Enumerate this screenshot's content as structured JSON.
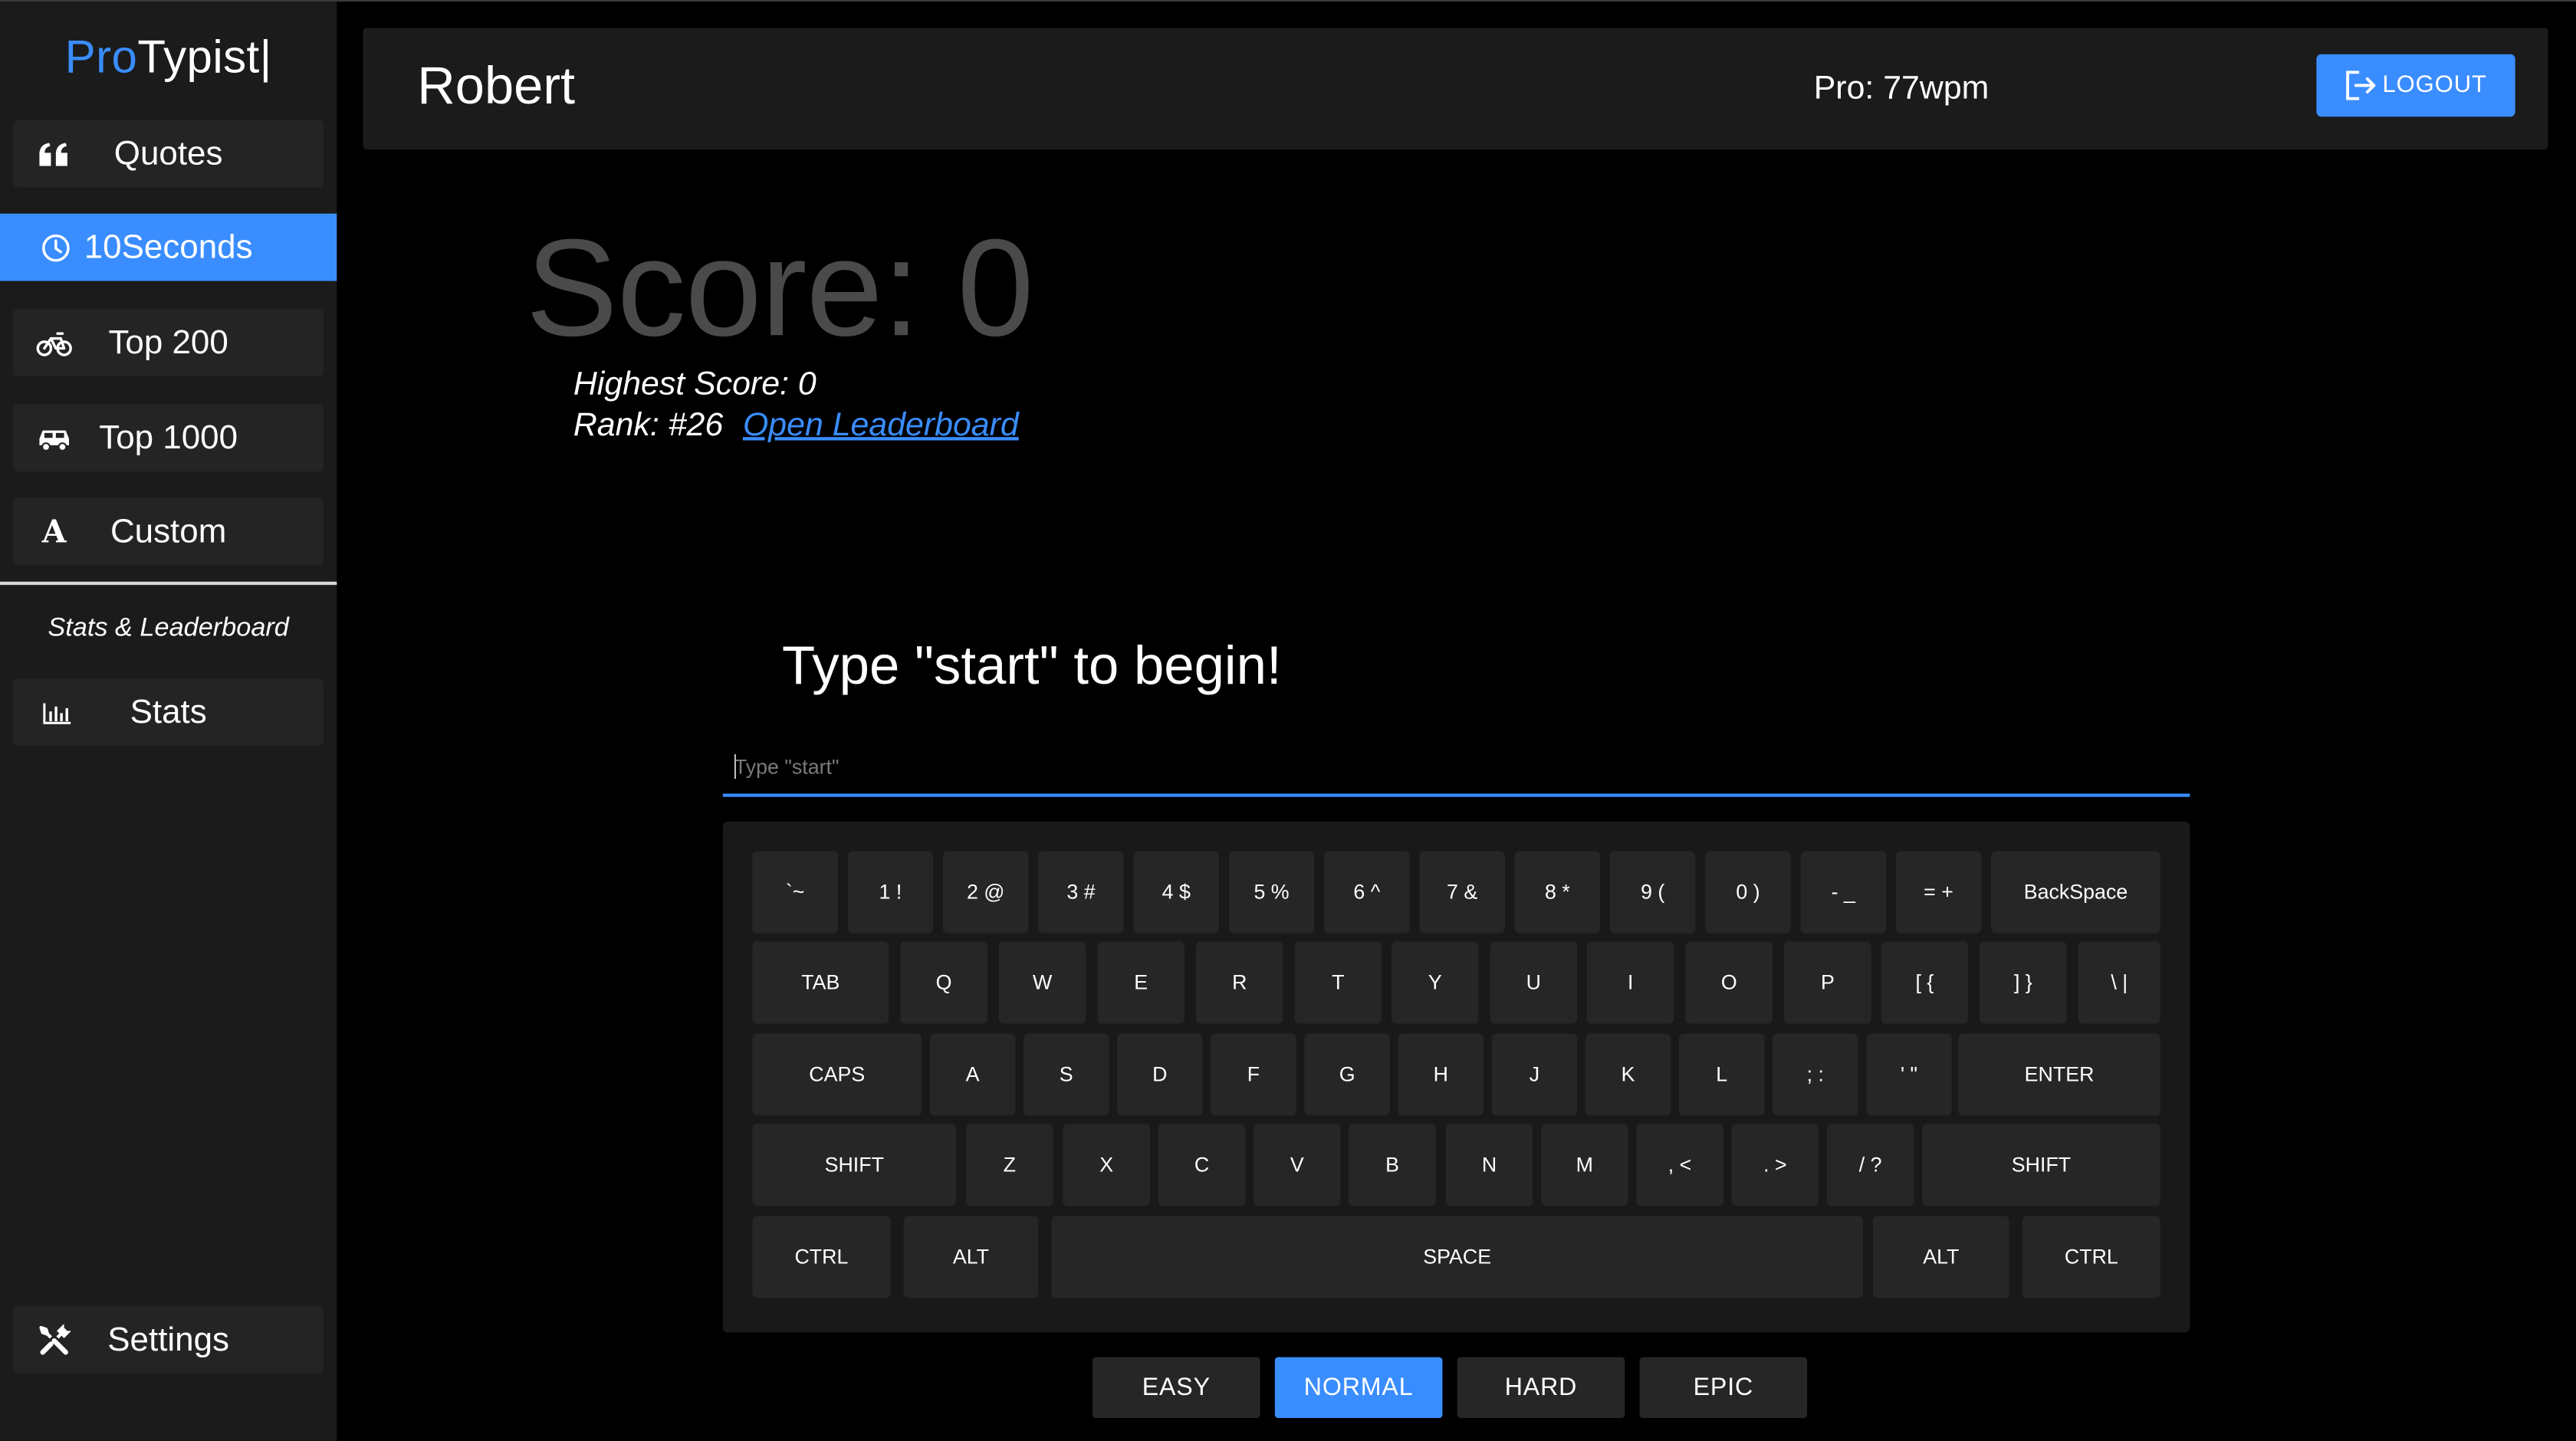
{
  "brand": {
    "pro": "Pro",
    "typist": "Typist|"
  },
  "sidebar": {
    "items": [
      {
        "label": "Quotes",
        "icon": "quote-icon"
      },
      {
        "label": "10Seconds",
        "icon": "clock-icon",
        "active": true
      },
      {
        "label": "Top 200",
        "icon": "bicycle-icon"
      },
      {
        "label": "Top 1000",
        "icon": "car-icon"
      },
      {
        "label": "Custom",
        "icon": "letter-a-icon"
      }
    ],
    "section_label": "Stats & Leaderboard",
    "stats_label": "Stats",
    "settings_label": "Settings"
  },
  "header": {
    "username": "Robert",
    "pro_text": "Pro: 77wpm",
    "logout_label": "LOGOUT"
  },
  "score": {
    "score_text": "Score: 0",
    "highest_text": "Highest Score: 0",
    "rank_text": "Rank: #26",
    "leaderboard_link": "Open Leaderboard"
  },
  "game": {
    "prompt": "Type \"start\" to begin!",
    "input_placeholder": "Type \"start\"",
    "input_value": ""
  },
  "keyboard": {
    "rows": [
      [
        "`~",
        "1 !",
        "2 @",
        "3 #",
        "4 $",
        "5 %",
        "6 ^",
        "7 &",
        "8 *",
        "9 (",
        "0 )",
        "- _",
        "= +",
        "BackSpace"
      ],
      [
        "TAB",
        "Q",
        "W",
        "E",
        "R",
        "T",
        "Y",
        "U",
        "I",
        "O",
        "P",
        "[ {",
        "] }",
        "\\ |"
      ],
      [
        "CAPS",
        "A",
        "S",
        "D",
        "F",
        "G",
        "H",
        "J",
        "K",
        "L",
        "; :",
        "' \"",
        "ENTER"
      ],
      [
        "SHIFT",
        "Z",
        "X",
        "C",
        "V",
        "B",
        "N",
        "M",
        ", <",
        ". >",
        "/ ?",
        "SHIFT"
      ],
      [
        "CTRL",
        "ALT",
        "SPACE",
        "ALT",
        "CTRL"
      ]
    ]
  },
  "difficulty": {
    "options": [
      "EASY",
      "NORMAL",
      "HARD",
      "EPIC"
    ],
    "selected": "NORMAL"
  },
  "colors": {
    "accent": "#3a8dff",
    "sidebar_bg": "#1b1b1b",
    "key_bg": "#262626",
    "score_gray": "#4a4a4a"
  }
}
